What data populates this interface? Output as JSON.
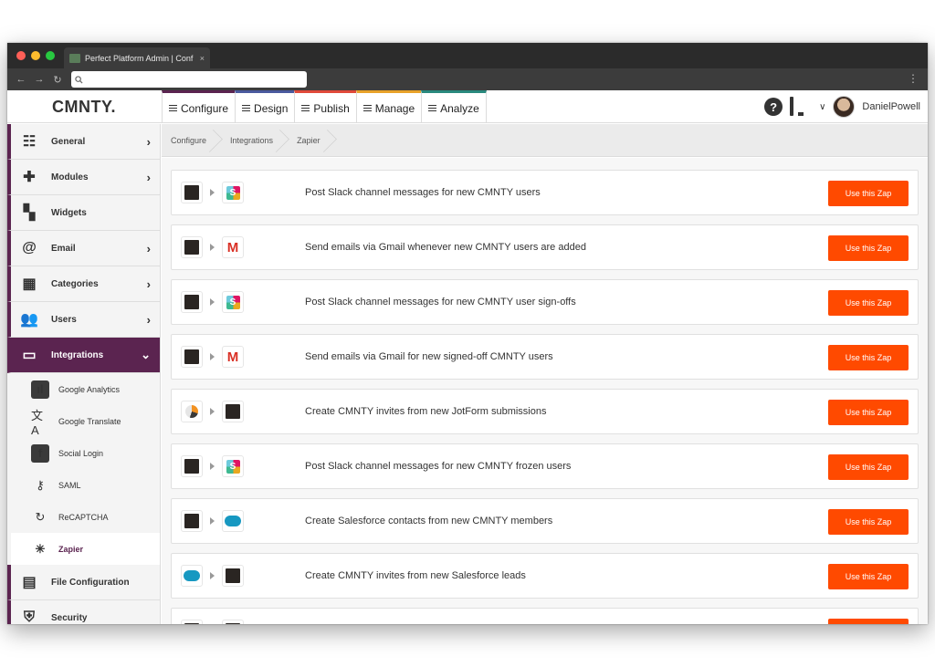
{
  "browser": {
    "tab_title": "Perfect Platform Admin | Conf",
    "tab_close": "×",
    "url": "",
    "url_icon": "search-icon"
  },
  "header": {
    "logo": "CMNTY.",
    "nav": [
      {
        "label": "Configure",
        "color": "#5b2450"
      },
      {
        "label": "Design",
        "color": "#4a5a9e"
      },
      {
        "label": "Publish",
        "color": "#e0493a"
      },
      {
        "label": "Manage",
        "color": "#e8a22a"
      },
      {
        "label": "Analyze",
        "color": "#2a8a7e"
      }
    ],
    "help": "?",
    "username": "DanielPowell"
  },
  "sidebar": {
    "items": [
      {
        "label": "General",
        "icon": "sliders-icon",
        "glyph": "☷",
        "arrow": "›"
      },
      {
        "label": "Modules",
        "icon": "puzzle-icon",
        "glyph": "✚",
        "arrow": "›"
      },
      {
        "label": "Widgets",
        "icon": "widgets-icon",
        "glyph": "▚",
        "arrow": ""
      },
      {
        "label": "Email",
        "icon": "at-icon",
        "glyph": "@",
        "arrow": "›"
      },
      {
        "label": "Categories",
        "icon": "grid-icon",
        "glyph": "▦",
        "arrow": "›"
      },
      {
        "label": "Users",
        "icon": "users-icon",
        "glyph": "👥",
        "arrow": "›"
      },
      {
        "label": "Integrations",
        "icon": "devices-icon",
        "glyph": "▭",
        "arrow": "⌄"
      }
    ],
    "subitems": [
      {
        "label": "Google Analytics",
        "icon": "bar-chart-icon",
        "glyph": "ıl"
      },
      {
        "label": "Google Translate",
        "icon": "translate-icon",
        "glyph": "文A"
      },
      {
        "label": "Social Login",
        "icon": "facebook-icon",
        "glyph": "f"
      },
      {
        "label": "SAML",
        "icon": "key-icon",
        "glyph": "⚷"
      },
      {
        "label": "ReCAPTCHA",
        "icon": "recaptcha-icon",
        "glyph": "↻"
      },
      {
        "label": "Zapier",
        "icon": "zapier-icon",
        "glyph": "✳"
      }
    ],
    "bottom_items": [
      {
        "label": "File Configuration",
        "icon": "file-gear-icon",
        "glyph": "▤"
      },
      {
        "label": "Security",
        "icon": "shield-icon",
        "glyph": "⛨"
      }
    ]
  },
  "breadcrumb": [
    "Configure",
    "Integrations",
    "Zapier"
  ],
  "zaps": [
    {
      "from": "cmnty",
      "to": "slack",
      "title": "Post Slack channel messages for new CMNTY users",
      "button": "Use this Zap"
    },
    {
      "from": "cmnty",
      "to": "gmail",
      "title": "Send emails via Gmail whenever new CMNTY users are added",
      "button": "Use this Zap"
    },
    {
      "from": "cmnty",
      "to": "slack",
      "title": "Post Slack channel messages for new CMNTY user sign-offs",
      "button": "Use this Zap"
    },
    {
      "from": "cmnty",
      "to": "gmail",
      "title": "Send emails via Gmail for new signed-off CMNTY users",
      "button": "Use this Zap"
    },
    {
      "from": "jotform",
      "to": "cmnty",
      "title": "Create CMNTY invites from new JotForm submissions",
      "button": "Use this Zap"
    },
    {
      "from": "cmnty",
      "to": "slack",
      "title": "Post Slack channel messages for new CMNTY frozen users",
      "button": "Use this Zap"
    },
    {
      "from": "cmnty",
      "to": "salesforce",
      "title": "Create Salesforce contacts from new CMNTY members",
      "button": "Use this Zap"
    },
    {
      "from": "salesforce",
      "to": "cmnty",
      "title": "Create CMNTY invites from new Salesforce leads",
      "button": "Use this Zap"
    },
    {
      "from": "cmnty",
      "to": "cmnty",
      "title": "",
      "button": ""
    }
  ],
  "colors": {
    "accent": "#5b2450",
    "zap_button": "#ff4a00"
  }
}
